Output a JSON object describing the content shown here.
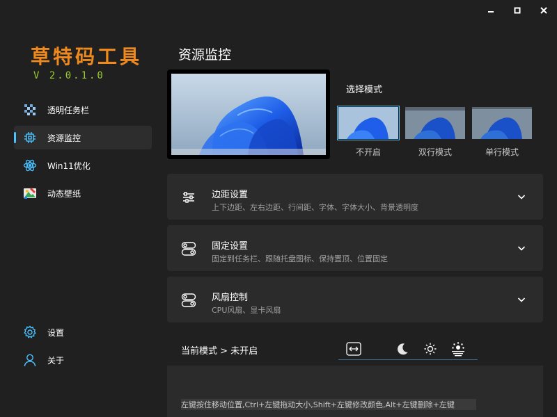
{
  "app": {
    "title": "草特码工具",
    "version": "V 2.0.1.0"
  },
  "window_controls": [
    {
      "name": "minimize-icon"
    },
    {
      "name": "maximize-icon"
    },
    {
      "name": "close-icon"
    }
  ],
  "sidebar": {
    "items": [
      {
        "label": "透明任务栏",
        "icon": "checker-icon",
        "active": false
      },
      {
        "label": "资源监控",
        "icon": "chip-icon",
        "active": true
      },
      {
        "label": "Win11优化",
        "icon": "atom-icon",
        "active": false
      },
      {
        "label": "动态壁纸",
        "icon": "palette-icon",
        "active": false
      }
    ],
    "bottom_items": [
      {
        "label": "设置",
        "icon": "gear-icon"
      },
      {
        "label": "关于",
        "icon": "user-icon"
      }
    ]
  },
  "main": {
    "page_title": "资源监控",
    "mode_section_title": "选择模式",
    "modes": [
      {
        "label": "不开启",
        "selected": true
      },
      {
        "label": "双行模式",
        "selected": false
      },
      {
        "label": "单行模式",
        "selected": false
      }
    ],
    "cards": [
      {
        "title": "边距设置",
        "subtitle": "上下边距、左右边距、行间距、字体、字体大小、背景透明度",
        "icon": "sliders-icon"
      },
      {
        "title": "固定设置",
        "subtitle": "固定到任务栏、跟随托盘图标、保持置顶、位置固定",
        "icon": "toggles-icon"
      },
      {
        "title": "风扇控制",
        "subtitle": "CPU风扇、显卡风扇",
        "icon": "toggles-icon"
      }
    ],
    "status_text": "当前模式 > 未开启",
    "toolbar": [
      {
        "name": "resize-width-icon"
      },
      {
        "name": "moon-icon"
      },
      {
        "name": "sun-icon"
      },
      {
        "name": "brightness-icon"
      }
    ],
    "hint": "左键按住移动位置,Ctrl+左键拖动大小,Shift+左键修改颜色,Alt+左键删除+左键"
  },
  "colors": {
    "background": "#202020",
    "card": "#2b2b2b",
    "accent": "#4cc2ff",
    "title_orange": "#ee8a1d",
    "version_green": "#9acd32"
  }
}
